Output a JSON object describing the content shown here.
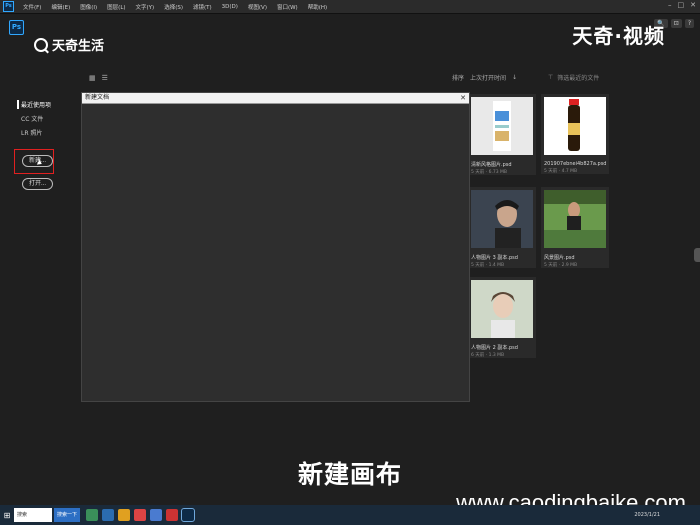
{
  "menubar": {
    "items": [
      "文件(F)",
      "编辑(E)",
      "图像(I)",
      "图层(L)",
      "文字(Y)",
      "选择(S)",
      "滤镜(T)",
      "3D(D)",
      "视图(V)",
      "窗口(W)",
      "帮助(H)"
    ],
    "window_controls": [
      "–",
      "□",
      "✕"
    ]
  },
  "header_right": {
    "search_label": "🔍",
    "button1": "⊡",
    "button2": "?"
  },
  "watermark_left": "天奇生活",
  "watermark_right": "天奇·视频",
  "sidebar": {
    "items": [
      {
        "label": "最近使用项"
      },
      {
        "label": "CC 文件"
      },
      {
        "label": "LR 照片"
      }
    ],
    "new_button": "新建...",
    "open_button": "打开..."
  },
  "toolbar": {
    "sort_label": "排序",
    "sort_value": "上次打开时间",
    "filter_placeholder": "筛选最近的文件"
  },
  "dialog": {
    "title": "新建文档",
    "close": "✕"
  },
  "recent_files": [
    {
      "name": "清新风格图片.psd",
      "meta": "5 天前 · 6.73 MB",
      "thumb_color": "#d8e4ef"
    },
    {
      "name": "201907ebnei4b827a.psd",
      "meta": "5 天前 · 4.7 MB",
      "thumb_color": "#f4efe9"
    },
    {
      "name": "人物图片 3 副本.psd",
      "meta": "5 天前 · 1.4 MB",
      "thumb_color": "#3b4450"
    },
    {
      "name": "风景图片.psd",
      "meta": "5 天前 · 2.9 MB",
      "thumb_color": "#4f7a3c"
    },
    {
      "name": "人物图片 2 副本.psd",
      "meta": "6 天前 · 1.3 MB",
      "thumb_color": "#cfd8c8"
    }
  ],
  "subtitle": "新建画布",
  "watermark_url": "www.caodingbaike.com",
  "taskbar": {
    "start_icon": "⊞",
    "search_placeholder": "搜索",
    "search_button": "搜索一下",
    "tray_text": "2023/1/21"
  }
}
